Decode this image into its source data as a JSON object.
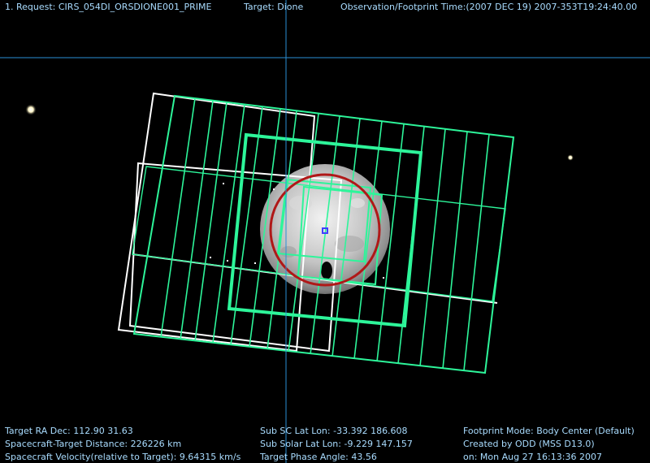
{
  "header": {
    "request": "1. Request: CIRS_054DI_ORSDIONE001_PRIME",
    "target": "Target: Dione",
    "obs_time": "Observation/Footprint Time:(2007 DEC 19) 2007-353T19:24:40.00"
  },
  "footer": {
    "left": [
      "Target RA Dec: 112.90  31.63",
      "Spacecraft-Target Distance:  226226 km",
      "Spacecraft Velocity(relative to Target): 9.64315 km/s"
    ],
    "middle": [
      "Sub SC Lat Lon: -33.392  186.608",
      "Sub Solar Lat Lon: -9.229  147.157",
      "Target Phase Angle: 43.56"
    ],
    "right": [
      "Footprint Mode: Body Center (Default)",
      "Created by ODD (MSS D13.0)",
      "on: Mon Aug 27 16:13:36 2007"
    ]
  },
  "colors": {
    "text": "#a9dcff",
    "crosshair": "#2a8fd6",
    "footprint_green": "#2df59a",
    "footprint_white": "#ffffff",
    "ring_red": "#b01818",
    "marker_blue": "#4040ff",
    "body_gray": "#b8b8b8"
  }
}
